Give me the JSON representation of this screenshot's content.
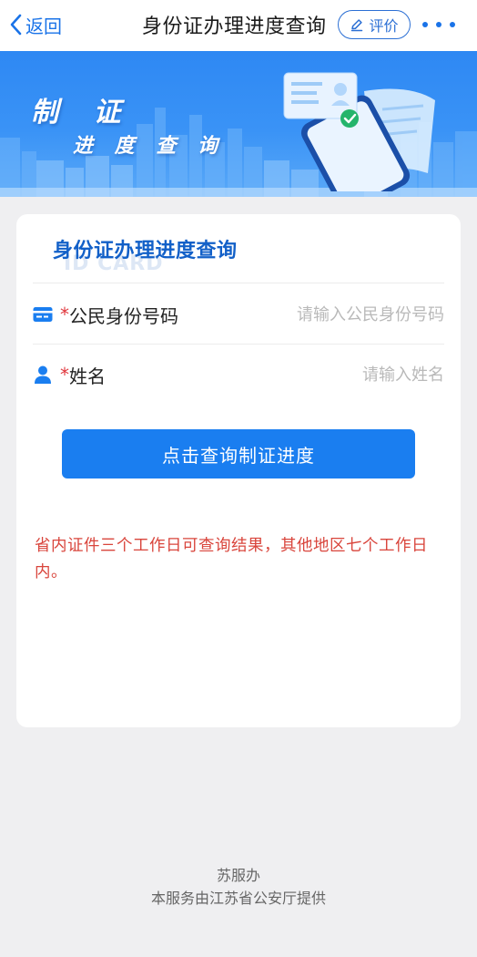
{
  "nav": {
    "back_label": "返回",
    "title": "身份证办理进度查询",
    "rate_label": "评价",
    "more_icon": "more-dots-icon"
  },
  "banner": {
    "line1": "制 证",
    "line2": "进 度 查 询"
  },
  "card": {
    "title": "身份证办理进度查询",
    "watermark": "ID CARD",
    "fields": [
      {
        "icon": "id-card-icon",
        "required_mark": "*",
        "label": "公民身份号码",
        "value": "",
        "placeholder": "请输入公民身份号码"
      },
      {
        "icon": "person-icon",
        "required_mark": "*",
        "label": "姓名",
        "value": "",
        "placeholder": "请输入姓名"
      }
    ],
    "submit_label": "点击查询制证进度",
    "notice": "省内证件三个工作日可查询结果，其他地区七个工作日内。"
  },
  "footer": {
    "brand": "苏服办",
    "provider": "本服务由江苏省公安厅提供"
  },
  "colors": {
    "accent": "#1a7ef0",
    "title_blue": "#1260c8",
    "notice_red": "#d9453c",
    "required_red": "#e0383e",
    "page_bg": "#efeff1"
  }
}
